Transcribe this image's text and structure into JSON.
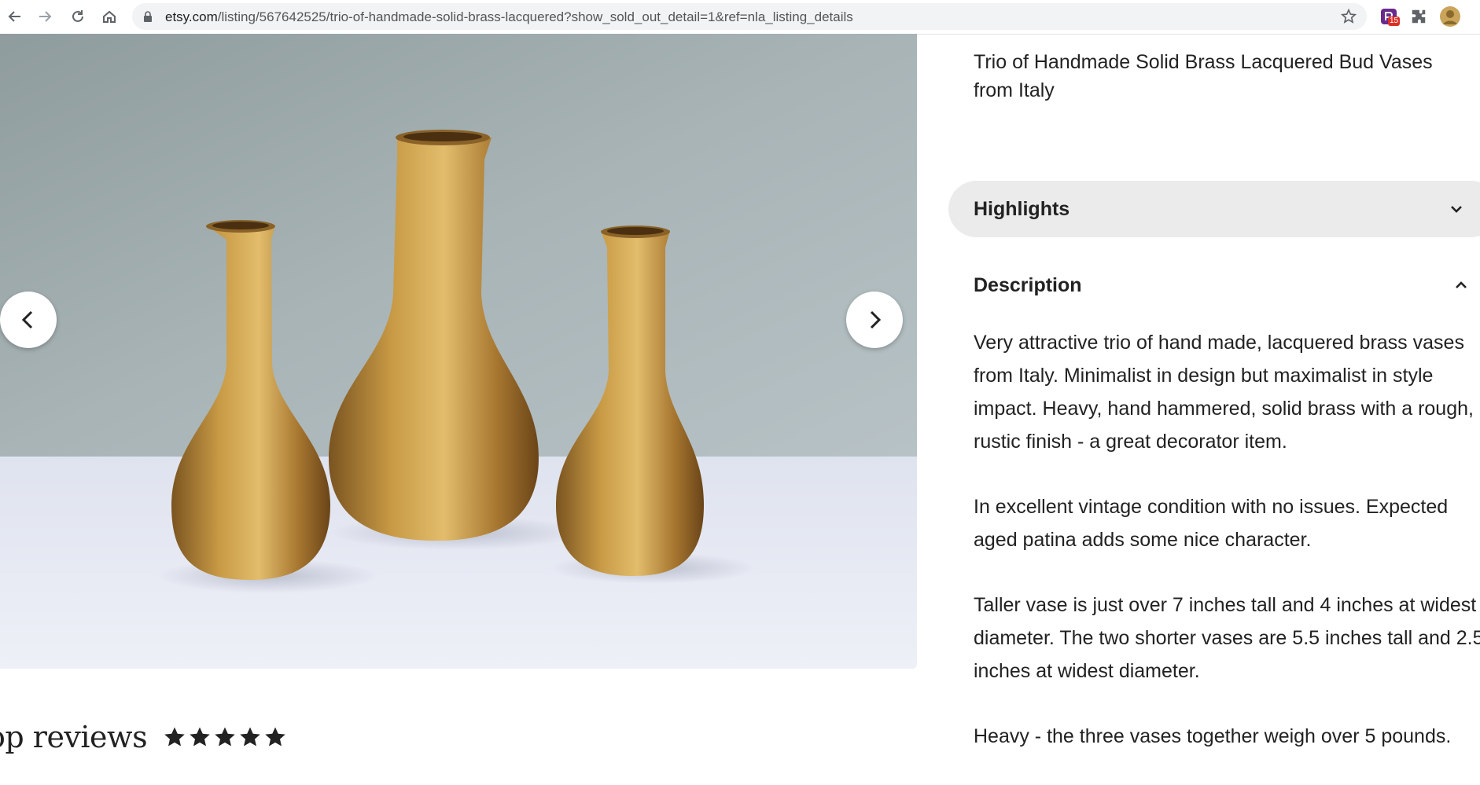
{
  "browser": {
    "url_host": "etsy.com",
    "url_path": "/listing/567642525/trio-of-handmade-solid-brass-lacquered?show_sold_out_detail=1&ref=nla_listing_details",
    "extension_badge": "15",
    "icons": [
      "back-icon",
      "forward-icon",
      "reload-icon",
      "home-icon",
      "lock-icon",
      "star-icon",
      "extension-icon",
      "puzzle-icon",
      "avatar"
    ]
  },
  "gallery": {
    "prev_icon": "chevron-left-icon",
    "next_icon": "chevron-right-icon"
  },
  "reviews": {
    "title": "op reviews",
    "rating_stars": 5
  },
  "listing": {
    "title": "Trio of Handmade Solid Brass Lacquered Bud Vases from Italy",
    "highlights_label": "Highlights",
    "description_label": "Description",
    "description": [
      "Very attractive trio of hand made, lacquered brass vases from Italy. Minimalist in design but maximalist in style impact. Heavy, hand hammered, solid brass with a rough, rustic finish - a great decorator item.",
      "In excellent vintage condition with no issues. Expected aged patina adds some nice character.",
      "Taller vase is just over 7 inches tall and 4 inches at widest diameter. The two shorter vases are 5.5 inches tall and 2.5 inches at widest diameter.",
      "Heavy - the three vases together weigh over 5 pounds."
    ]
  },
  "colors": {
    "text": "#222222",
    "highlight_bg": "#ebebeb",
    "brass": "#b8893a",
    "wall": "#9aa8a8",
    "table": "#e6e9f2"
  }
}
